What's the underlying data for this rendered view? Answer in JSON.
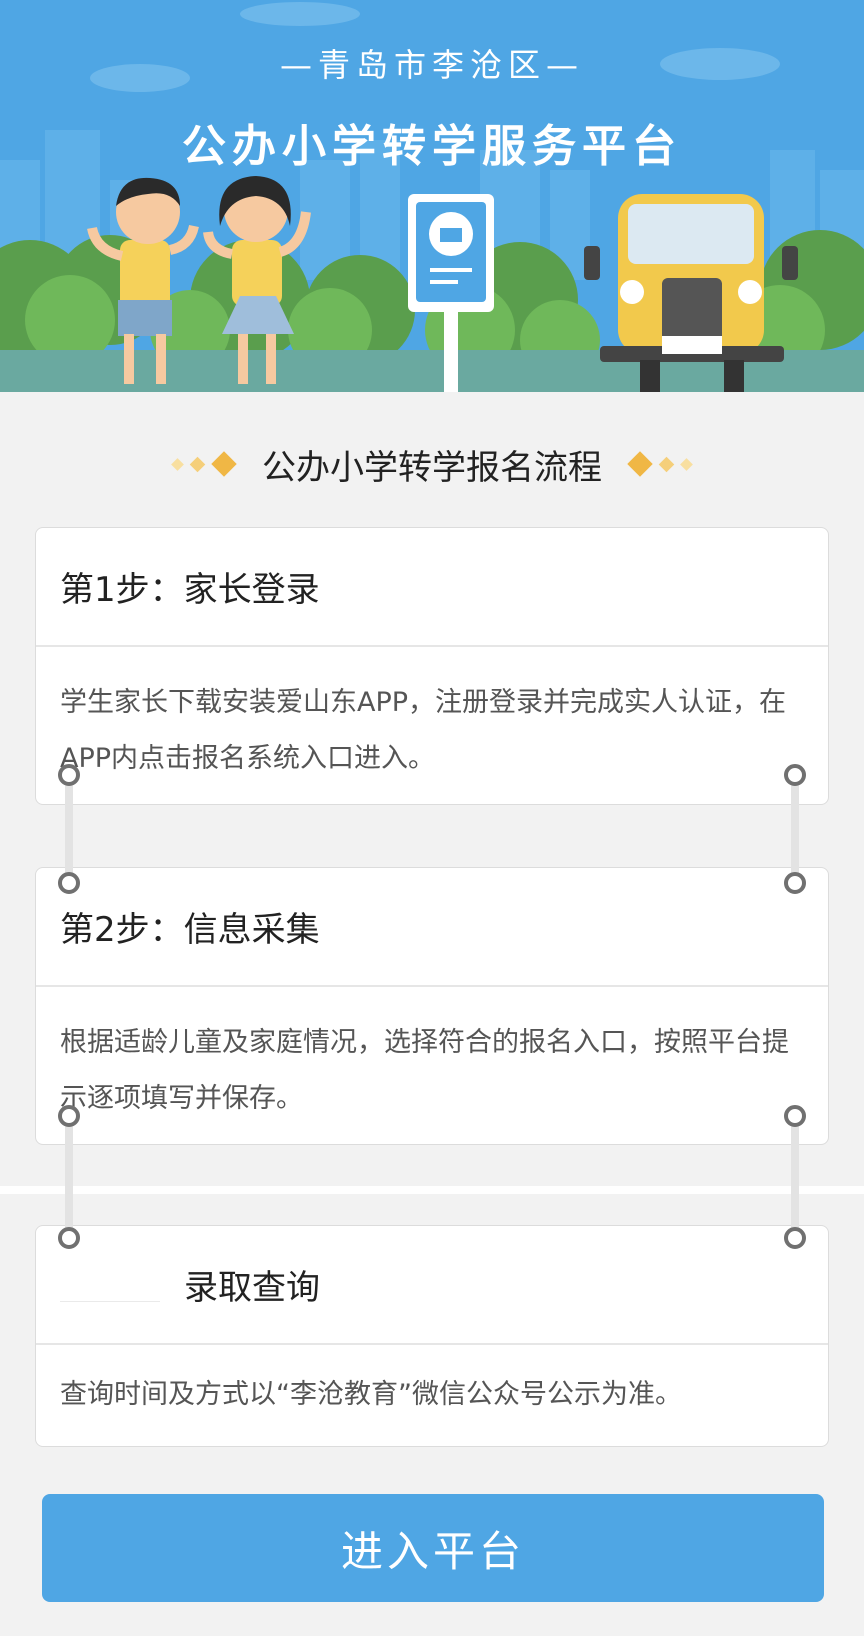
{
  "banner": {
    "subtitle": "—青岛市李沧区—",
    "title": "公办小学转学服务平台"
  },
  "section": {
    "title": "公办小学转学报名流程"
  },
  "steps": [
    {
      "title": "第1步：家长登录",
      "description": "学生家长下载安装爱山东APP，注册登录并完成实人认证，在APP内点击报名系统入口进入。"
    },
    {
      "title": "第2步：信息采集",
      "description": "根据适龄儿童及家庭情况，选择符合的报名入口，按照平台提示逐项填写并保存。"
    },
    {
      "title": "录取查询",
      "description": "查询时间及方式以“李沧教育”微信公众号公示为准。"
    }
  ],
  "actions": {
    "enter_label": "进入平台"
  },
  "colors": {
    "primary": "#4fa6e4",
    "accent": "#f0b745"
  }
}
